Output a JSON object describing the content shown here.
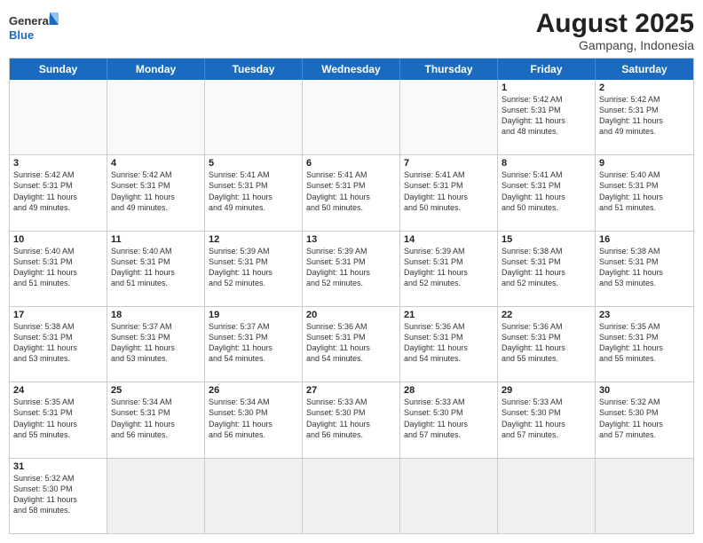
{
  "logo": {
    "general": "General",
    "blue": "Blue"
  },
  "title": "August 2025",
  "location": "Gampang, Indonesia",
  "days_of_week": [
    "Sunday",
    "Monday",
    "Tuesday",
    "Wednesday",
    "Thursday",
    "Friday",
    "Saturday"
  ],
  "weeks": [
    [
      {
        "day": "",
        "info": "",
        "empty": true
      },
      {
        "day": "",
        "info": "",
        "empty": true
      },
      {
        "day": "",
        "info": "",
        "empty": true
      },
      {
        "day": "",
        "info": "",
        "empty": true
      },
      {
        "day": "",
        "info": "",
        "empty": true
      },
      {
        "day": "1",
        "info": "Sunrise: 5:42 AM\nSunset: 5:31 PM\nDaylight: 11 hours\nand 48 minutes."
      },
      {
        "day": "2",
        "info": "Sunrise: 5:42 AM\nSunset: 5:31 PM\nDaylight: 11 hours\nand 49 minutes."
      }
    ],
    [
      {
        "day": "3",
        "info": "Sunrise: 5:42 AM\nSunset: 5:31 PM\nDaylight: 11 hours\nand 49 minutes."
      },
      {
        "day": "4",
        "info": "Sunrise: 5:42 AM\nSunset: 5:31 PM\nDaylight: 11 hours\nand 49 minutes."
      },
      {
        "day": "5",
        "info": "Sunrise: 5:41 AM\nSunset: 5:31 PM\nDaylight: 11 hours\nand 49 minutes."
      },
      {
        "day": "6",
        "info": "Sunrise: 5:41 AM\nSunset: 5:31 PM\nDaylight: 11 hours\nand 50 minutes."
      },
      {
        "day": "7",
        "info": "Sunrise: 5:41 AM\nSunset: 5:31 PM\nDaylight: 11 hours\nand 50 minutes."
      },
      {
        "day": "8",
        "info": "Sunrise: 5:41 AM\nSunset: 5:31 PM\nDaylight: 11 hours\nand 50 minutes."
      },
      {
        "day": "9",
        "info": "Sunrise: 5:40 AM\nSunset: 5:31 PM\nDaylight: 11 hours\nand 51 minutes."
      }
    ],
    [
      {
        "day": "10",
        "info": "Sunrise: 5:40 AM\nSunset: 5:31 PM\nDaylight: 11 hours\nand 51 minutes."
      },
      {
        "day": "11",
        "info": "Sunrise: 5:40 AM\nSunset: 5:31 PM\nDaylight: 11 hours\nand 51 minutes."
      },
      {
        "day": "12",
        "info": "Sunrise: 5:39 AM\nSunset: 5:31 PM\nDaylight: 11 hours\nand 52 minutes."
      },
      {
        "day": "13",
        "info": "Sunrise: 5:39 AM\nSunset: 5:31 PM\nDaylight: 11 hours\nand 52 minutes."
      },
      {
        "day": "14",
        "info": "Sunrise: 5:39 AM\nSunset: 5:31 PM\nDaylight: 11 hours\nand 52 minutes."
      },
      {
        "day": "15",
        "info": "Sunrise: 5:38 AM\nSunset: 5:31 PM\nDaylight: 11 hours\nand 52 minutes."
      },
      {
        "day": "16",
        "info": "Sunrise: 5:38 AM\nSunset: 5:31 PM\nDaylight: 11 hours\nand 53 minutes."
      }
    ],
    [
      {
        "day": "17",
        "info": "Sunrise: 5:38 AM\nSunset: 5:31 PM\nDaylight: 11 hours\nand 53 minutes."
      },
      {
        "day": "18",
        "info": "Sunrise: 5:37 AM\nSunset: 5:31 PM\nDaylight: 11 hours\nand 53 minutes."
      },
      {
        "day": "19",
        "info": "Sunrise: 5:37 AM\nSunset: 5:31 PM\nDaylight: 11 hours\nand 54 minutes."
      },
      {
        "day": "20",
        "info": "Sunrise: 5:36 AM\nSunset: 5:31 PM\nDaylight: 11 hours\nand 54 minutes."
      },
      {
        "day": "21",
        "info": "Sunrise: 5:36 AM\nSunset: 5:31 PM\nDaylight: 11 hours\nand 54 minutes."
      },
      {
        "day": "22",
        "info": "Sunrise: 5:36 AM\nSunset: 5:31 PM\nDaylight: 11 hours\nand 55 minutes."
      },
      {
        "day": "23",
        "info": "Sunrise: 5:35 AM\nSunset: 5:31 PM\nDaylight: 11 hours\nand 55 minutes."
      }
    ],
    [
      {
        "day": "24",
        "info": "Sunrise: 5:35 AM\nSunset: 5:31 PM\nDaylight: 11 hours\nand 55 minutes."
      },
      {
        "day": "25",
        "info": "Sunrise: 5:34 AM\nSunset: 5:31 PM\nDaylight: 11 hours\nand 56 minutes."
      },
      {
        "day": "26",
        "info": "Sunrise: 5:34 AM\nSunset: 5:30 PM\nDaylight: 11 hours\nand 56 minutes."
      },
      {
        "day": "27",
        "info": "Sunrise: 5:33 AM\nSunset: 5:30 PM\nDaylight: 11 hours\nand 56 minutes."
      },
      {
        "day": "28",
        "info": "Sunrise: 5:33 AM\nSunset: 5:30 PM\nDaylight: 11 hours\nand 57 minutes."
      },
      {
        "day": "29",
        "info": "Sunrise: 5:33 AM\nSunset: 5:30 PM\nDaylight: 11 hours\nand 57 minutes."
      },
      {
        "day": "30",
        "info": "Sunrise: 5:32 AM\nSunset: 5:30 PM\nDaylight: 11 hours\nand 57 minutes."
      }
    ],
    [
      {
        "day": "31",
        "info": "Sunrise: 5:32 AM\nSunset: 5:30 PM\nDaylight: 11 hours\nand 58 minutes."
      },
      {
        "day": "",
        "info": "",
        "empty": true
      },
      {
        "day": "",
        "info": "",
        "empty": true
      },
      {
        "day": "",
        "info": "",
        "empty": true
      },
      {
        "day": "",
        "info": "",
        "empty": true
      },
      {
        "day": "",
        "info": "",
        "empty": true
      },
      {
        "day": "",
        "info": "",
        "empty": true
      }
    ]
  ]
}
